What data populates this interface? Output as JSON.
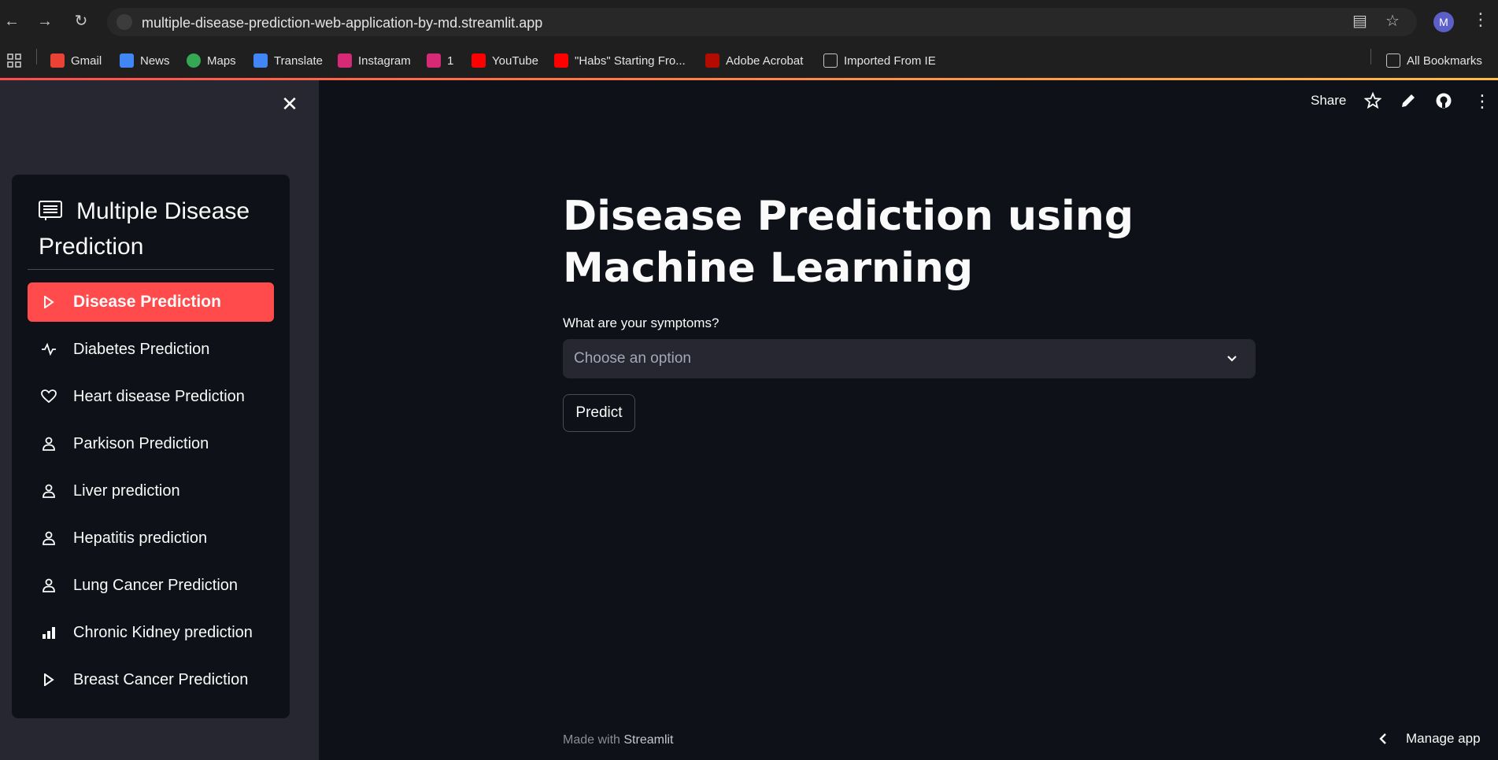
{
  "browser": {
    "url": "multiple-disease-prediction-web-application-by-md.streamlit.app",
    "profile_initial": "M",
    "bookmarks": [
      "Gmail",
      "News",
      "Maps",
      "Translate",
      "Instagram",
      "1",
      "YouTube",
      "\"Habs\" Starting Fro...",
      "Adobe Acrobat",
      "Imported From IE"
    ],
    "all_bookmarks": "All Bookmarks"
  },
  "sidebar": {
    "title": "Multiple Disease Prediction",
    "items": [
      {
        "label": "Disease Prediction",
        "icon": "play-icon",
        "active": true
      },
      {
        "label": "Diabetes Prediction",
        "icon": "activity-icon"
      },
      {
        "label": "Heart disease Prediction",
        "icon": "heart-icon"
      },
      {
        "label": "Parkison Prediction",
        "icon": "person-icon"
      },
      {
        "label": "Liver prediction",
        "icon": "person-icon"
      },
      {
        "label": "Hepatitis prediction",
        "icon": "person-icon"
      },
      {
        "label": "Lung Cancer Prediction",
        "icon": "person-icon"
      },
      {
        "label": "Chronic Kidney prediction",
        "icon": "bar-chart-icon"
      },
      {
        "label": "Breast Cancer Prediction",
        "icon": "play-icon"
      }
    ]
  },
  "toolbar": {
    "share": "Share"
  },
  "main": {
    "title": "Disease Prediction using Machine Learning",
    "symptoms_label": "What are your symptoms?",
    "select_placeholder": "Choose an option",
    "predict_label": "Predict"
  },
  "footer": {
    "made_with": "Made with",
    "brand": "Streamlit",
    "manage_app": "Manage app"
  },
  "colors": {
    "accent": "#ff4b4b",
    "background": "#0e1117",
    "sidebar": "#262730"
  }
}
